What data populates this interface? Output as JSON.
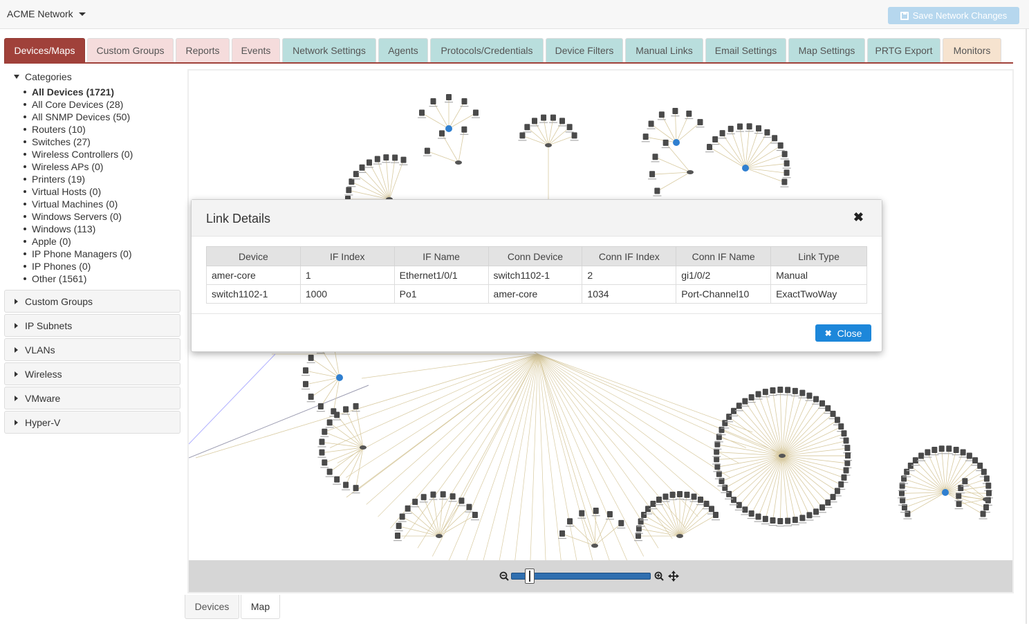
{
  "header": {
    "network_name": "ACME Network",
    "save_label": "Save Network Changes"
  },
  "tabs": [
    {
      "label": "Devices/Maps",
      "style": "active"
    },
    {
      "label": "Custom Groups",
      "style": "pink"
    },
    {
      "label": "Reports",
      "style": "pink"
    },
    {
      "label": "Events",
      "style": "pink"
    },
    {
      "label": "Network Settings",
      "style": "teal"
    },
    {
      "label": "Agents",
      "style": "teal"
    },
    {
      "label": "Protocols/Credentials",
      "style": "teal"
    },
    {
      "label": "Device Filters",
      "style": "teal"
    },
    {
      "label": "Manual Links",
      "style": "teal"
    },
    {
      "label": "Email Settings",
      "style": "teal"
    },
    {
      "label": "Map Settings",
      "style": "teal"
    },
    {
      "label": "PRTG Export",
      "style": "teal"
    },
    {
      "label": "Monitors",
      "style": "peach"
    }
  ],
  "sidebar": {
    "categories_label": "Categories",
    "categories": [
      "All Devices (1721)",
      "All Core Devices (28)",
      "All SNMP Devices (50)",
      "Routers (10)",
      "Switches (27)",
      "Wireless Controllers (0)",
      "Wireless APs (0)",
      "Printers (19)",
      "Virtual Hosts (0)",
      "Virtual Machines (0)",
      "Windows Servers (0)",
      "Windows (113)",
      "Apple (0)",
      "IP Phone Managers (0)",
      "IP Phones (0)",
      "Other (1561)"
    ],
    "sections": [
      "Custom Groups",
      "IP Subnets",
      "VLANs",
      "Wireless",
      "VMware",
      "Hyper-V"
    ]
  },
  "modal": {
    "title": "Link Details",
    "close_label": "Close",
    "columns": [
      "Device",
      "IF Index",
      "IF Name",
      "Conn Device",
      "Conn IF Index",
      "Conn IF Name",
      "Link Type"
    ],
    "rows": [
      [
        "amer-core",
        "1",
        "Ethernet1/0/1",
        "switch1102-1",
        "2",
        "gi1/0/2",
        "Manual"
      ],
      [
        "switch1102-1",
        "1000",
        "Po1",
        "amer-core",
        "1034",
        "Port-Channel10",
        "ExactTwoWay"
      ]
    ]
  },
  "bottom_tabs": [
    "Devices",
    "Map"
  ],
  "colors": {
    "active_tab": "#a0413a",
    "link_line": "#d8caa0",
    "node": "#4a4a4a",
    "globe": "#2f7fd0",
    "primary_button": "#1d87da"
  }
}
